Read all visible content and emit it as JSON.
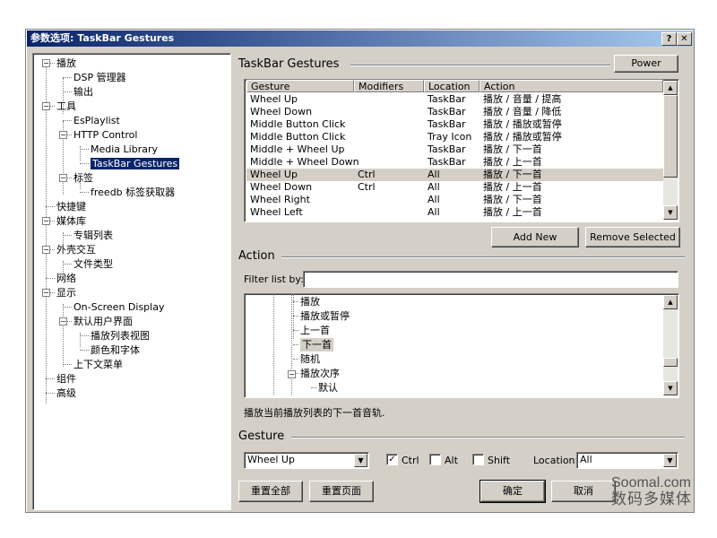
{
  "window": {
    "title": "参数选项: TaskBar Gestures",
    "help_label": "?",
    "close_label": "✕"
  },
  "tree": {
    "items": [
      {
        "label": "播放"
      },
      {
        "label": "DSP 管理器"
      },
      {
        "label": "输出"
      },
      {
        "label": "工具"
      },
      {
        "label": "EsPlaylist"
      },
      {
        "label": "HTTP Control"
      },
      {
        "label": "Media Library"
      },
      {
        "label": "TaskBar Gestures"
      },
      {
        "label": "标签"
      },
      {
        "label": "freedb 标签获取器"
      },
      {
        "label": "快捷键"
      },
      {
        "label": "媒体库"
      },
      {
        "label": "专辑列表"
      },
      {
        "label": "外壳交互"
      },
      {
        "label": "文件类型"
      },
      {
        "label": "网络"
      },
      {
        "label": "显示"
      },
      {
        "label": "On-Screen Display"
      },
      {
        "label": "默认用户界面"
      },
      {
        "label": "播放列表视图"
      },
      {
        "label": "颜色和字体"
      },
      {
        "label": "上下文菜单"
      },
      {
        "label": "组件"
      },
      {
        "label": "高级"
      }
    ],
    "expander_minus": "−"
  },
  "header": {
    "title": "TaskBar Gestures",
    "power_label": "Power"
  },
  "gestures_table": {
    "columns": [
      "Gesture",
      "Modifiers",
      "Location",
      "Action"
    ],
    "rows": [
      {
        "gesture": "Wheel Up",
        "modifiers": "",
        "location": "TaskBar",
        "action": "播放 / 音量 / 提高"
      },
      {
        "gesture": "Wheel Down",
        "modifiers": "",
        "location": "TaskBar",
        "action": "播放 / 音量 / 降低"
      },
      {
        "gesture": "Middle Button Click",
        "modifiers": "",
        "location": "TaskBar",
        "action": "播放 / 播放或暂停"
      },
      {
        "gesture": "Middle Button Click",
        "modifiers": "",
        "location": "Tray Icon",
        "action": "播放 / 播放或暂停"
      },
      {
        "gesture": "Middle + Wheel Up",
        "modifiers": "",
        "location": "TaskBar",
        "action": "播放 / 下一首"
      },
      {
        "gesture": "Middle + Wheel Down",
        "modifiers": "",
        "location": "TaskBar",
        "action": "播放 / 上一首"
      },
      {
        "gesture": "Wheel Up",
        "modifiers": "Ctrl",
        "location": "All",
        "action": "播放 / 下一首"
      },
      {
        "gesture": "Wheel Down",
        "modifiers": "Ctrl",
        "location": "All",
        "action": "播放 / 上一首"
      },
      {
        "gesture": "Wheel Right",
        "modifiers": "",
        "location": "All",
        "action": "播放 / 下一首"
      },
      {
        "gesture": "Wheel Left",
        "modifiers": "",
        "location": "All",
        "action": "播放 / 上一首"
      }
    ],
    "add_label": "Add New",
    "remove_label": "Remove Selected",
    "scroll_up": "▲",
    "scroll_down": "▼"
  },
  "action_section": {
    "title": "Action",
    "filter_label": "Filter list by:",
    "filter_value": "",
    "tree_items": [
      "播放",
      "播放或暂停",
      "上一首",
      "下一首",
      "随机",
      "播放次序",
      "默认"
    ],
    "description": "播放当前播放列表的下一首音轨."
  },
  "gesture_section": {
    "title": "Gesture",
    "gesture_value": "Wheel Up",
    "ctrl_label": "Ctrl",
    "ctrl_check": "✓",
    "alt_label": "Alt",
    "shift_label": "Shift",
    "location_label": "Location:",
    "location_value": "All"
  },
  "footer": {
    "reset_all": "重置全部",
    "reset_page": "重置页面",
    "ok": "确定",
    "cancel": "取消"
  },
  "watermark": {
    "line1": "Soomal.com",
    "line2": "数码多媒体"
  }
}
